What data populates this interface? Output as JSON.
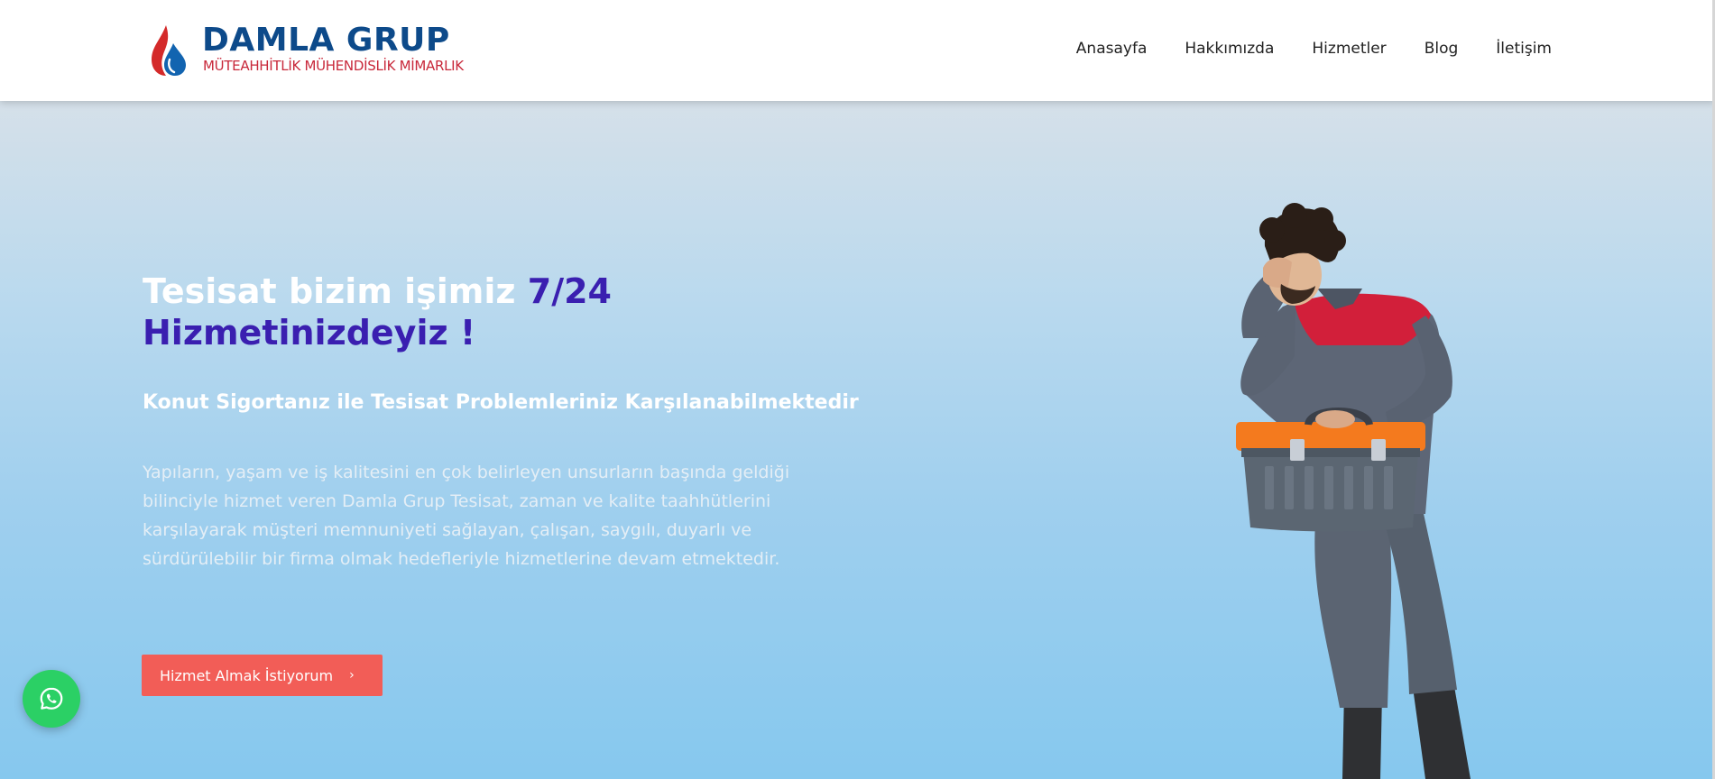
{
  "header": {
    "logo": {
      "name": "DAMLA GRUP",
      "subtitle": "MÜTEAHHİTLİK  MÜHENDİSLİK  MİMARLIK"
    },
    "nav": [
      {
        "label": "Anasayfa"
      },
      {
        "label": "Hakkımızda"
      },
      {
        "label": "Hizmetler"
      },
      {
        "label": "Blog"
      },
      {
        "label": "İletişim"
      }
    ]
  },
  "hero": {
    "title_white": "Tesisat bizim işimiz ",
    "title_accent_1": "7/24",
    "title_accent_2": "Hizmetinizdeyiz !",
    "subtitle": "Konut Sigortanız ile Tesisat Problemleriniz Karşılanabilmektedir",
    "description": "Yapıların, yaşam ve iş kalitesini en çok belirleyen unsurların başında geldiği bilinciyle hizmet veren Damla Grup Tesisat, zaman ve kalite taahhütlerini karşılayarak müşteri memnuniyeti sağlayan, çalışan, saygılı, duyarlı ve sürdürülebilir bir firma olmak hedefleriyle hizmetlerine devam etmektedir.",
    "cta_label": "Hizmet Almak İstiyorum",
    "cta_icon": "chevron-right-icon"
  },
  "floating": {
    "whatsapp_icon": "whatsapp-icon"
  },
  "colors": {
    "accent": "#3a1fb0",
    "cta": "#f25d57",
    "whatsapp": "#2bd065",
    "brand_blue": "#0d4a8a",
    "brand_red": "#c8283a"
  }
}
